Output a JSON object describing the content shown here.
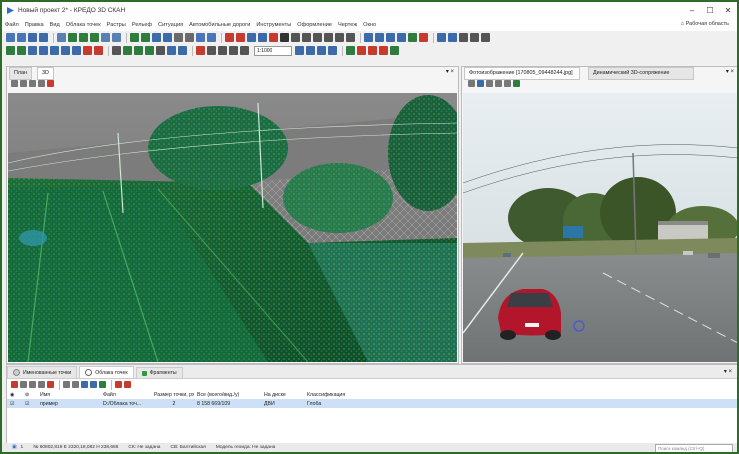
{
  "window": {
    "title": "Новый проект 2* - КРЕДО 3D СКАН",
    "controls": {
      "minimize": "–",
      "maximize": "☐",
      "close": "✕"
    }
  },
  "menu": {
    "items": [
      "Файл",
      "Правка",
      "Вид",
      "Облака точек",
      "Растры",
      "Рельеф",
      "Ситуация",
      "Автомобильные дороги",
      "Инструменты",
      "Оформление",
      "Чертеж",
      "Окно"
    ],
    "region_label": "⌂ Рабочая область"
  },
  "toolbar": {
    "scale_value": "1:1000"
  },
  "left_panel": {
    "tabs": [
      "План",
      "3D"
    ],
    "controls": "▾ × "
  },
  "right_panel": {
    "tabs": [
      "Фотоизображение [170805_09448244.jpg]",
      "Динамический 3D-сопряжение"
    ],
    "controls": "▾ ×"
  },
  "bottom_panel": {
    "tabs": [
      "Именованные точки",
      "Облака точек",
      "Фрагменты"
    ],
    "controls": "▾ ×",
    "columns": [
      "Имя",
      "Файл",
      "Размер точки, px",
      "Все (всего/вид./у)",
      "На диске",
      "Классификация"
    ],
    "rows": [
      {
        "name": "пример",
        "file": "D:/Облака точ...",
        "point_size": "2",
        "count": "8 158 669/109",
        "on_disk": "ДВИ",
        "class": "Глоба"
      }
    ]
  },
  "status": {
    "items": [
      "1",
      "№ 60802,819 Е 2320,18,082 Н 238,686",
      "СК: Не задана",
      "СВ: Балтийская",
      "Модель геоида: Не задана"
    ],
    "search_placeholder": "Поиск команд (Ctrl+Q)"
  },
  "colors": {
    "frame": "#2f6b28",
    "selection": "#cde0f5",
    "pointcloud_green": "#2f9a4a"
  }
}
